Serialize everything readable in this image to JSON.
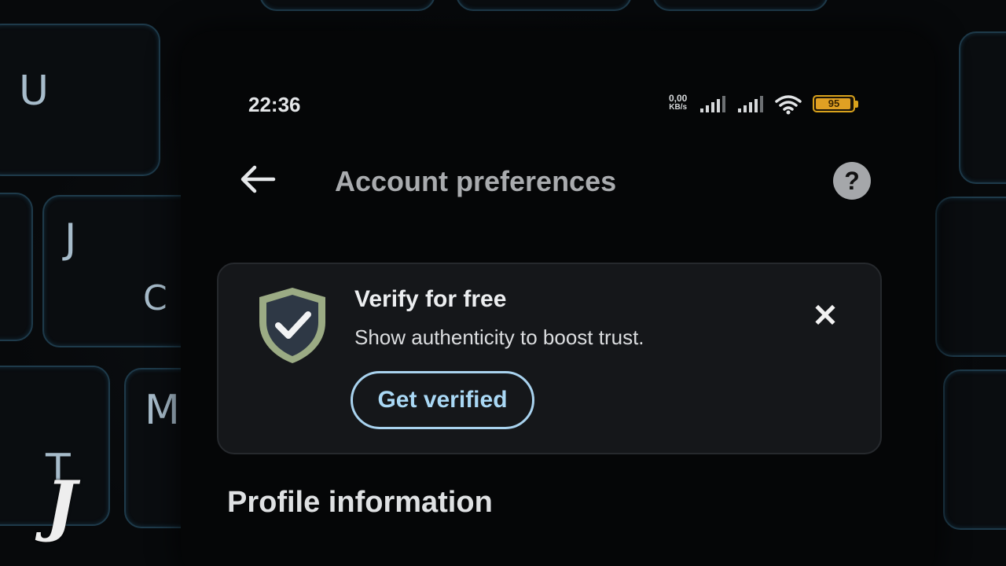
{
  "status_bar": {
    "time": "22:36",
    "net_speed_value": "0,00",
    "net_speed_unit": "KB/s",
    "battery_level": "95",
    "signal_icon": "cellular-signal-icon",
    "wifi_icon": "wifi-icon",
    "battery_icon": "battery-icon",
    "battery_color": "#e0a023"
  },
  "header": {
    "back_icon": "back-arrow-icon",
    "title": "Account preferences",
    "help_icon": "help-circle-icon",
    "help_glyph": "?"
  },
  "verify_card": {
    "icon": "verified-shield-icon",
    "title": "Verify for free",
    "subtitle": "Show authenticity to boost trust.",
    "button_label": "Get verified",
    "close_glyph": "✕",
    "accent_color": "#a9d8f5",
    "shield_color": "#9bab84"
  },
  "sections": {
    "profile_title": "Profile information"
  },
  "keyboard_keys": [
    "U",
    "J",
    "C",
    "T",
    "M"
  ],
  "watermark_letter": "J"
}
